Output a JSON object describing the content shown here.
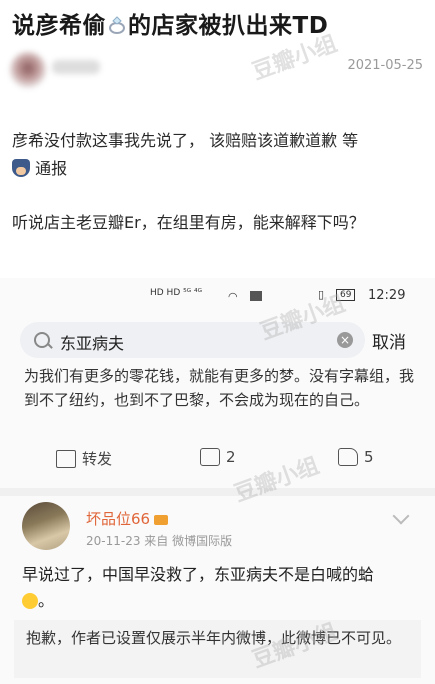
{
  "post": {
    "title_part1": "说彦希偷",
    "title_part2": "的店家被扒出来TD",
    "date": "2021-05-25",
    "line1": "彦希没付款这事我先说了， 该赔赔该道歉道歉 等",
    "line2": "通报",
    "line3": "听说店主老豆瓣Er，在组里有房，能来解释下吗？"
  },
  "embedded": {
    "status": {
      "time": "12:29",
      "battery": "69"
    },
    "search": {
      "query": "东亚病夫",
      "cancel_label": "取消"
    },
    "quote": "为我们有更多的零花钱，就能有更多的梦。没有字幕组，我到不了纽约，也到不了巴黎，不会成为现在的自己。",
    "actions": {
      "share_label": "转发",
      "comment_count": "2",
      "like_count": "5"
    },
    "comment": {
      "username": "坏品位66",
      "meta": "20-11-23  来自 微博国际版",
      "text": "早说过了，中国早没救了，东亚病夫不是白喊的蛤",
      "notice": "抱歉，作者已设置仅展示半年内微博，此微博已不可见。"
    }
  },
  "watermark": "豆瓣小组"
}
